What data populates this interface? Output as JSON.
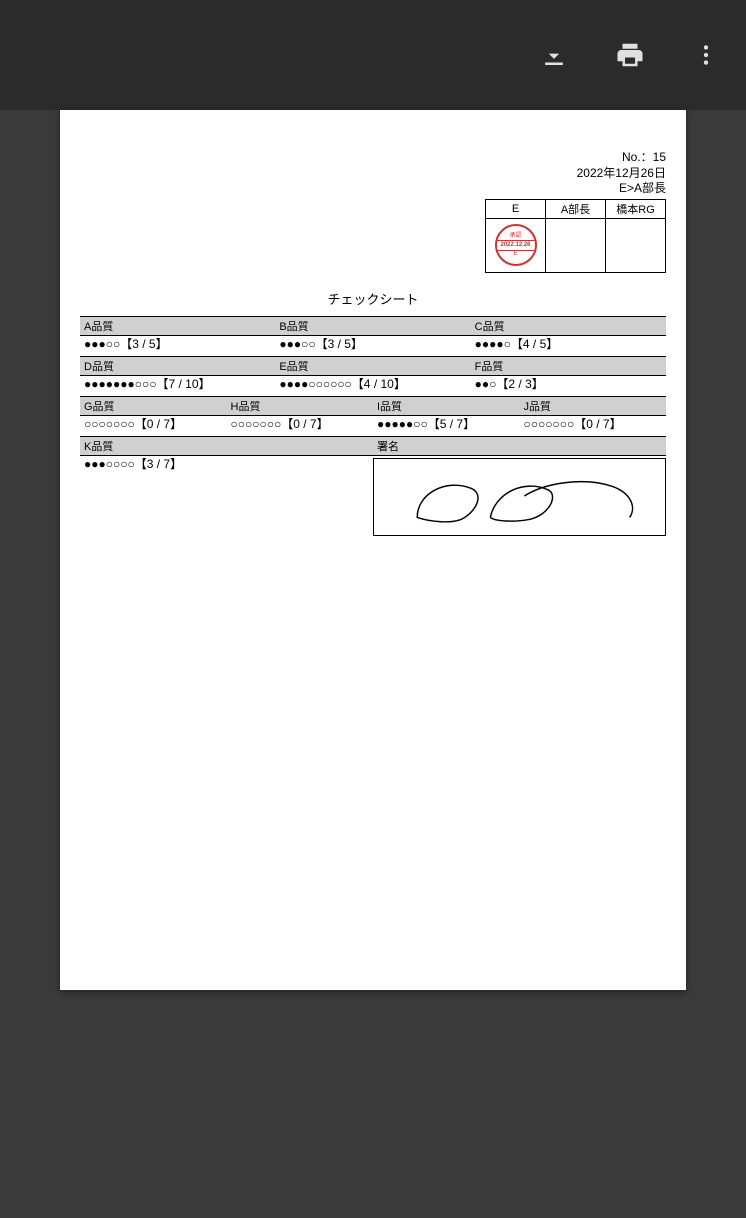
{
  "toolbar": {
    "download": "download-icon",
    "print": "print-icon",
    "more": "more-vert-icon"
  },
  "doc": {
    "no_label": "No.：",
    "no_value": "15",
    "date": "2022年12月26日",
    "route": "E>A部長",
    "approvers": [
      "E",
      "A部長",
      "橋本RG"
    ],
    "stamp": {
      "top": "承認",
      "date": "2022.12.26",
      "name": "E"
    },
    "title": "チェックシート",
    "signature_label": "署名",
    "rows": [
      [
        {
          "label": "A品質",
          "dots": "●●●○○【3 / 5】"
        },
        {
          "label": "B品質",
          "dots": "●●●○○【3 / 5】"
        },
        {
          "label": "C品質",
          "dots": "●●●●○【4 / 5】"
        }
      ],
      [
        {
          "label": "D品質",
          "dots": "●●●●●●●○○○【7 / 10】"
        },
        {
          "label": "E品質",
          "dots": "●●●●○○○○○○【4 / 10】"
        },
        {
          "label": "F品質",
          "dots": "●●○【2 / 3】"
        }
      ],
      [
        {
          "label": "G品質",
          "dots": "○○○○○○○【0 / 7】"
        },
        {
          "label": "H品質",
          "dots": "○○○○○○○【0 / 7】"
        },
        {
          "label": "I品質",
          "dots": "●●●●●○○【5 / 7】"
        },
        {
          "label": "J品質",
          "dots": "○○○○○○○【0 / 7】"
        }
      ],
      [
        {
          "label": "K品質",
          "dots": "●●●○○○○【3 / 7】"
        }
      ]
    ]
  }
}
